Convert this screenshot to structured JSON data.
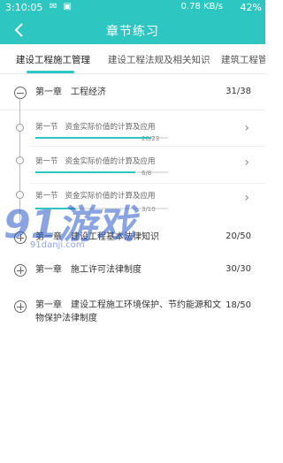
{
  "status_bar": {
    "time": "3:10:05",
    "network": "0.78 KB/s",
    "battery": "42%"
  },
  "app_bar": {
    "title": "章节练习",
    "back_icon": "back-arrow-icon"
  },
  "tabs": [
    {
      "label": "建设工程施工管理",
      "active": true
    },
    {
      "label": "建设工程法规及相关知识",
      "active": false
    },
    {
      "label": "建筑工程管",
      "active": false
    }
  ],
  "chapters": [
    {
      "number": "第一章",
      "title": "工程经济",
      "count": "31/38",
      "expanded": true,
      "sections": [
        {
          "number": "第一节",
          "title": "资金实际价值的计算及应用",
          "progress_text": "20/23",
          "progress": 0.87
        },
        {
          "number": "第一节",
          "title": "资金实际价值的计算及应用",
          "progress_text": "6/8",
          "progress": 0.75
        },
        {
          "number": "第一节",
          "title": "资金实际价值的计算及应用",
          "progress_text": "3/10",
          "progress": 0.3
        }
      ]
    },
    {
      "number": "第一章",
      "title": "建设工程基本法律知识",
      "count": "20/50",
      "expanded": false
    },
    {
      "number": "第一章",
      "title": "施工许可法律制度",
      "count": "30/30",
      "expanded": false
    },
    {
      "number": "第一章",
      "title": "建设工程施工环境保护、节约能源和文物保护法律制度",
      "count": "18/50",
      "expanded": false
    }
  ],
  "watermark": {
    "logo": "91游戏",
    "url": "91danji.com"
  },
  "colors": {
    "accent": "#2ec6c0"
  }
}
